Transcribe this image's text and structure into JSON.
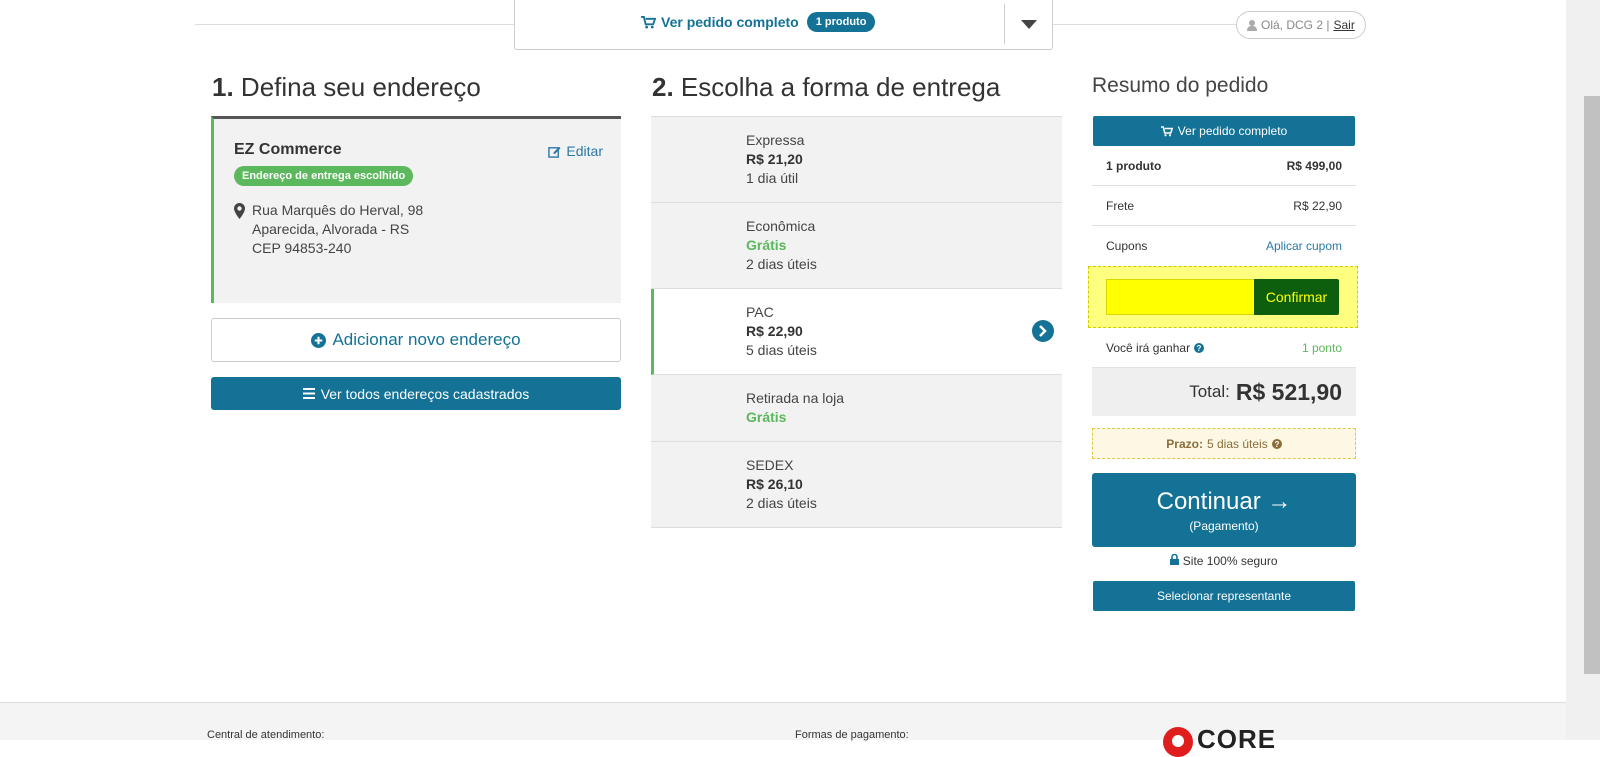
{
  "header": {
    "cart_link_label": "Ver pedido completo",
    "cart_badge": "1 produto",
    "greeting": "Olá, DCG 2 |",
    "logout": "Sair"
  },
  "address_section": {
    "step_number": "1.",
    "title": "Defina seu endereço",
    "card": {
      "name": "EZ Commerce",
      "edit_label": "Editar",
      "chosen_badge": "Endereço de entrega escolhido",
      "line1": "Rua Marquês do Herval, 98",
      "line2": "Aparecida, Alvorada - RS",
      "line3": "CEP 94853-240"
    },
    "add_button": "Adicionar novo endereço",
    "view_all_button": "Ver todos endereços cadastrados"
  },
  "shipping_section": {
    "step_number": "2.",
    "title": "Escolha a forma de entrega",
    "options": [
      {
        "name": "Expressa",
        "price": "R$ 21,20",
        "time": "1 dia útil",
        "free": false,
        "selected": false
      },
      {
        "name": "Econômica",
        "price": "Grátis",
        "time": "2 dias úteis",
        "free": true,
        "selected": false
      },
      {
        "name": "PAC",
        "price": "R$ 22,90",
        "time": "5 dias úteis",
        "free": false,
        "selected": true
      },
      {
        "name": "Retirada na loja",
        "price": "Grátis",
        "time": "",
        "free": true,
        "selected": false
      },
      {
        "name": "SEDEX",
        "price": "R$ 26,10",
        "time": "2 dias úteis",
        "free": false,
        "selected": false
      }
    ]
  },
  "summary": {
    "title": "Resumo do pedido",
    "view_order_button": "Ver pedido completo",
    "products_label": "1 produto",
    "products_value": "R$ 499,00",
    "shipping_label": "Frete",
    "shipping_value": "R$ 22,90",
    "coupons_label": "Cupons",
    "coupons_link": "Aplicar cupom",
    "coupon_input_value": "",
    "confirm_button": "Confirmar",
    "earn_label": "Você irá ganhar",
    "earn_value": "1 ponto",
    "total_label": "Total:",
    "total_value": "R$ 521,90",
    "deadline_label": "Prazo:",
    "deadline_value": "5 dias úteis",
    "continue_main": "Continuar →",
    "continue_sub": "(Pagamento)",
    "secure_label": "Site 100% seguro",
    "rep_button": "Selecionar representante"
  },
  "footer": {
    "support_label": "Central de atendimento:",
    "payment_label": "Formas de pagamento:",
    "logo_text": "CORE"
  },
  "colors": {
    "primary": "#137295",
    "success": "#5cb85c",
    "highlight": "#ffff00"
  }
}
